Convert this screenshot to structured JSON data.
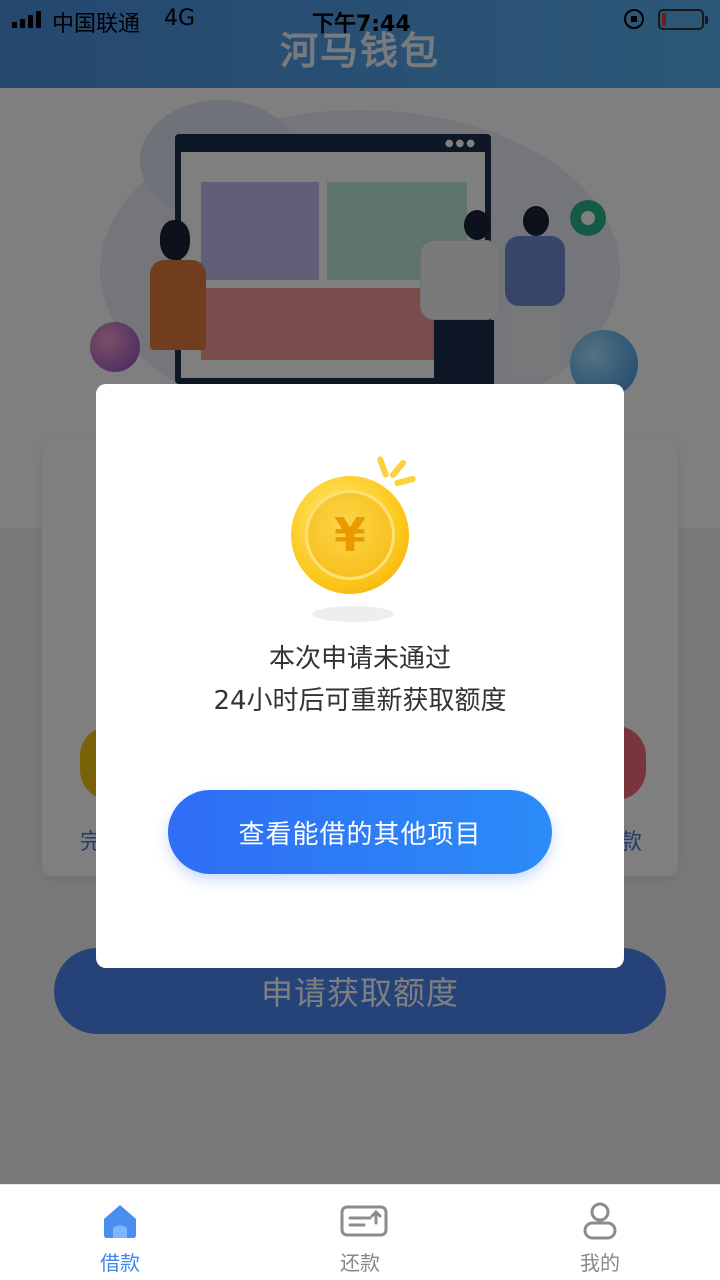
{
  "status_bar": {
    "carrier": "中国联通",
    "network": "4G",
    "time": "下午7:44"
  },
  "header": {
    "title": "河马钱包"
  },
  "card": {
    "left_label": "完",
    "right_label": "款"
  },
  "apply_button": {
    "label": "申请获取额度"
  },
  "modal": {
    "message_line1": "本次申请未通过",
    "message_line2": "24小时后可重新获取额度",
    "coin_symbol": "¥",
    "button_label": "查看能借的其他项目"
  },
  "tabbar": {
    "items": [
      {
        "label": "借款",
        "icon": "home-icon",
        "active": true
      },
      {
        "label": "还款",
        "icon": "repay-icon",
        "active": false
      },
      {
        "label": "我的",
        "icon": "user-icon",
        "active": false
      }
    ]
  },
  "colors": {
    "accent": "#3e87ea",
    "modal_button": "#2f6df5",
    "coin": "#fcc81c"
  }
}
